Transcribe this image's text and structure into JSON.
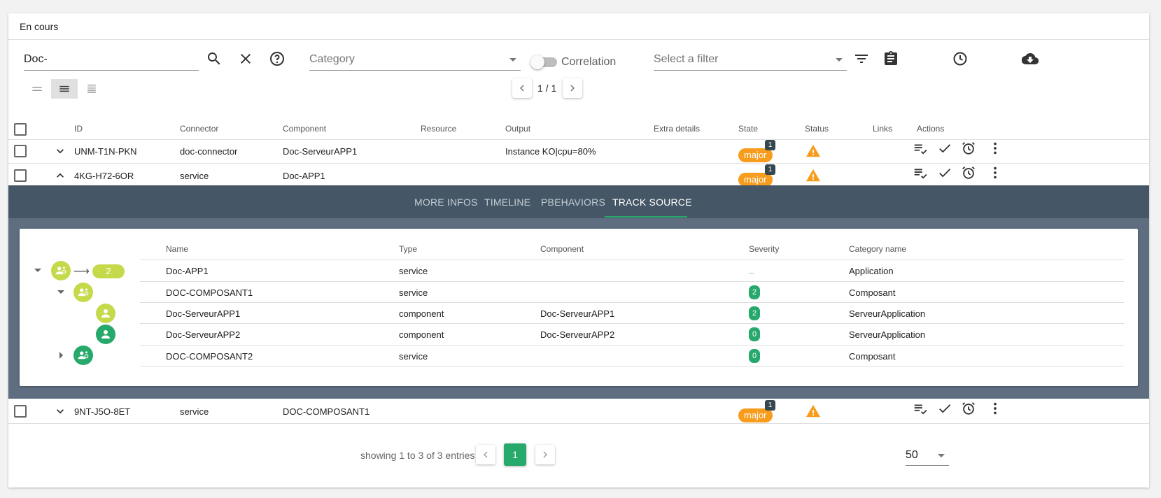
{
  "card": {
    "title": "En cours"
  },
  "toolbar": {
    "search_value": "Doc-",
    "category_placeholder": "Category",
    "correlation_label": "Correlation",
    "filter_placeholder": "Select a filter",
    "pagination": "1 / 1"
  },
  "columns": {
    "id": "ID",
    "connector": "Connector",
    "component": "Component",
    "resource": "Resource",
    "output": "Output",
    "extra": "Extra details",
    "state": "State",
    "status": "Status",
    "links": "Links",
    "actions": "Actions"
  },
  "rows": [
    {
      "id": "UNM-T1N-PKN",
      "connector": "doc-connector",
      "component": "Doc-ServeurAPP1",
      "resource": "",
      "output": "Instance KO|cpu=80%",
      "state": "major",
      "state_count": "1"
    },
    {
      "id": "4KG-H72-6OR",
      "connector": "service",
      "component": "Doc-APP1",
      "resource": "",
      "output": "",
      "state": "major",
      "state_count": "1"
    },
    {
      "id": "9NT-J5O-8ET",
      "connector": "service",
      "component": "DOC-COMPOSANT1",
      "resource": "",
      "output": "",
      "state": "major",
      "state_count": "1"
    }
  ],
  "tabs": [
    "MORE INFOS",
    "TIMELINE",
    "PBEHAVIORS",
    "TRACK SOURCE"
  ],
  "active_tab": "TRACK SOURCE",
  "tree": {
    "columns": {
      "name": "Name",
      "type": "Type",
      "component": "Component",
      "severity": "Severity",
      "category": "Category name"
    },
    "root_count": "2",
    "rows": [
      {
        "name": "Doc-APP1",
        "type": "service",
        "component": "",
        "severity": "_",
        "category": "Application"
      },
      {
        "name": "DOC-COMPOSANT1",
        "type": "service",
        "component": "",
        "severity": "2",
        "category": "Composant"
      },
      {
        "name": "Doc-ServeurAPP1",
        "type": "component",
        "component": "Doc-ServeurAPP1",
        "severity": "2",
        "category": "ServeurApplication"
      },
      {
        "name": "Doc-ServeurAPP2",
        "type": "component",
        "component": "Doc-ServeurAPP2",
        "severity": "0",
        "category": "ServeurApplication"
      },
      {
        "name": "DOC-COMPOSANT2",
        "type": "service",
        "component": "",
        "severity": "0",
        "category": "Composant"
      }
    ]
  },
  "footer": {
    "showing": "showing 1 to 3 of 3 entries",
    "current_page": "1",
    "per_page": "50"
  },
  "colors": {
    "accent": "#26a96b",
    "major": "#f79c1d",
    "panel": "#5e6e80",
    "tabbar": "#455767",
    "node_lime": "#c5d94a"
  },
  "icons": [
    "search-icon",
    "close-icon",
    "help-icon",
    "filter-icon",
    "clipboard-icon",
    "clock-icon",
    "cloud-download-icon",
    "warning-icon",
    "ack-icon",
    "check-icon",
    "alarm-icon",
    "more-icon",
    "service-icon",
    "person-icon"
  ]
}
